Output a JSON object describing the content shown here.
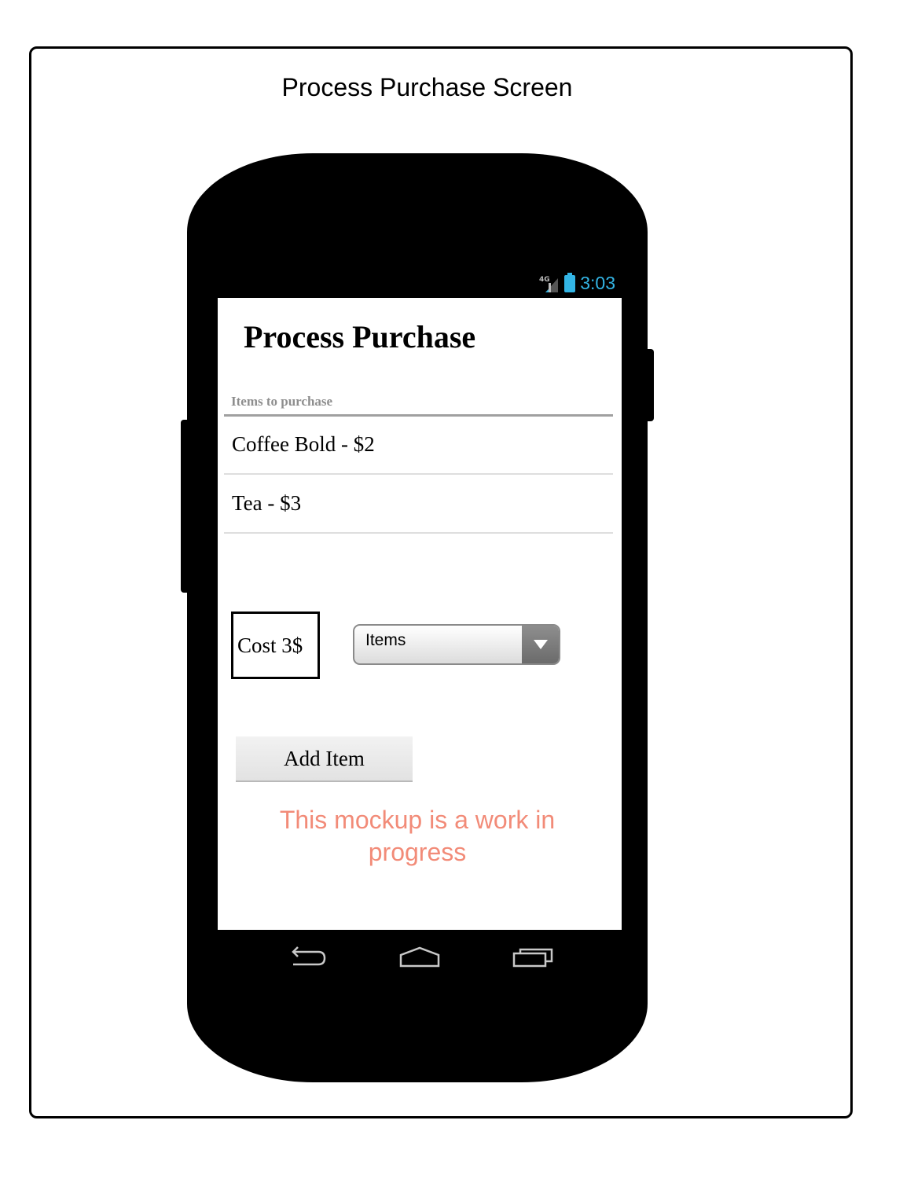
{
  "page": {
    "title": "Process Purchase Screen"
  },
  "status_bar": {
    "network": "4G",
    "time": "3:03",
    "accent_color": "#33b5e5"
  },
  "app": {
    "title": "Process Purchase",
    "list_header": "Items to purchase",
    "items": [
      {
        "label": "Coffee Bold - $2"
      },
      {
        "label": "Tea - $3"
      }
    ],
    "cost_label": "Cost 3$",
    "dropdown": {
      "selected": "Items"
    },
    "add_button_label": "Add Item",
    "note": "This mockup is a work in progress",
    "note_color": "#f28b78"
  },
  "nav_bar": {
    "icons": [
      "back-icon",
      "home-icon",
      "recent-apps-icon"
    ]
  }
}
